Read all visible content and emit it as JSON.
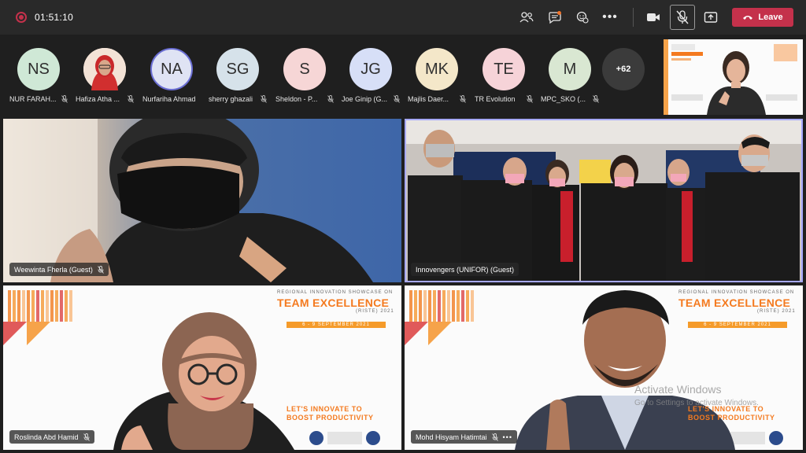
{
  "call": {
    "timer": "01:51:10",
    "leave_label": "Leave",
    "toolbar_icons": [
      "people-icon",
      "chat-icon",
      "reactions-icon",
      "more-options-icon",
      "camera-icon",
      "mic-muted-icon",
      "share-icon"
    ]
  },
  "participants_strip": [
    {
      "initials": "NS",
      "name": "NUR FARAH...",
      "color": "#cfe8d6"
    },
    {
      "initials": "",
      "name": "Hafiza Atha ...",
      "color": "#f3e2d6"
    },
    {
      "initials": "NA",
      "name": "Nurfariha Ahmad",
      "color": "#dfe3f4"
    },
    {
      "initials": "SG",
      "name": "sherry ghazali",
      "color": "#d6e2ea"
    },
    {
      "initials": "S",
      "name": "Sheldon - P...",
      "color": "#f6d6d6"
    },
    {
      "initials": "JG",
      "name": "Joe Ginip (G...",
      "color": "#d7dff7"
    },
    {
      "initials": "MK",
      "name": "Majlis Daer...",
      "color": "#f4e7c9"
    },
    {
      "initials": "TE",
      "name": "TR Evolution",
      "color": "#f6d3d8"
    },
    {
      "initials": "M",
      "name": "MPC_SKO (...",
      "color": "#d9e7d2"
    }
  ],
  "more_count": "+62",
  "tiles": [
    {
      "name": "Weewinta Fherla (Guest)"
    },
    {
      "name": "Innovengers (UNIFOR) (Guest)"
    },
    {
      "name": "Roslinda Abd Hamid"
    },
    {
      "name": "Mohd Hisyam Hatimtai"
    }
  ],
  "banner": {
    "top_line": "REGIONAL INNOVATION SHOWCASE ON",
    "title": "TEAM EXCELLENCE",
    "subtitle": "(RISTE) 2021",
    "date": "6 - 9 SEPTEMBER 2021",
    "slogan_line1": "LET'S INNOVATE TO",
    "slogan_line2": "BOOST PRODUCTIVITY"
  },
  "watermark": {
    "title": "Activate Windows",
    "subtitle": "Go to Settings to activate Windows."
  },
  "colors": {
    "leave": "#c4314b",
    "accent": "#f47a1f",
    "active_border": "#a7a9ff"
  }
}
